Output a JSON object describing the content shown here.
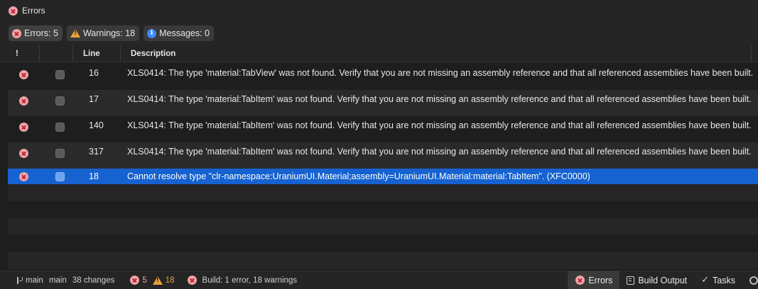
{
  "panel": {
    "title": "Errors"
  },
  "filters": {
    "errors_label": "Errors: 5",
    "warnings_label": "Warnings: 18",
    "messages_label": "Messages: 0"
  },
  "columns": {
    "severity": "!",
    "line": "Line",
    "description": "Description"
  },
  "rows": [
    {
      "line": "16",
      "description": "XLS0414: The type 'material:TabView' was not found. Verify that you are not missing an assembly reference and that all referenced assemblies have been built."
    },
    {
      "line": "17",
      "description": "XLS0414: The type 'material:TabItem' was not found. Verify that you are not missing an assembly reference and that all referenced assemblies have been built."
    },
    {
      "line": "140",
      "description": "XLS0414: The type 'material:TabItem' was not found. Verify that you are not missing an assembly reference and that all referenced assemblies have been built."
    },
    {
      "line": "317",
      "description": "XLS0414: The type 'material:TabItem' was not found. Verify that you are not missing an assembly reference and that all referenced assemblies have been built."
    },
    {
      "line": "18",
      "description": "Cannot resolve type \"clr-namespace:UraniumUI.Material;assembly=UraniumUI.Material:material:TabItem\". (XFC0000)"
    }
  ],
  "statusbar": {
    "branch": "main",
    "repo": "main",
    "changes": "38 changes",
    "error_count": "5",
    "warning_count": "18",
    "build_status": "Build: 1 error, 18 warnings"
  },
  "bottom_tabs": {
    "errors": "Errors",
    "build_output": "Build Output",
    "tasks": "Tasks"
  },
  "colors": {
    "selection": "#1662d0",
    "error": "#f0a3a8",
    "warning": "#e8a33a",
    "info": "#3d8bfd"
  }
}
